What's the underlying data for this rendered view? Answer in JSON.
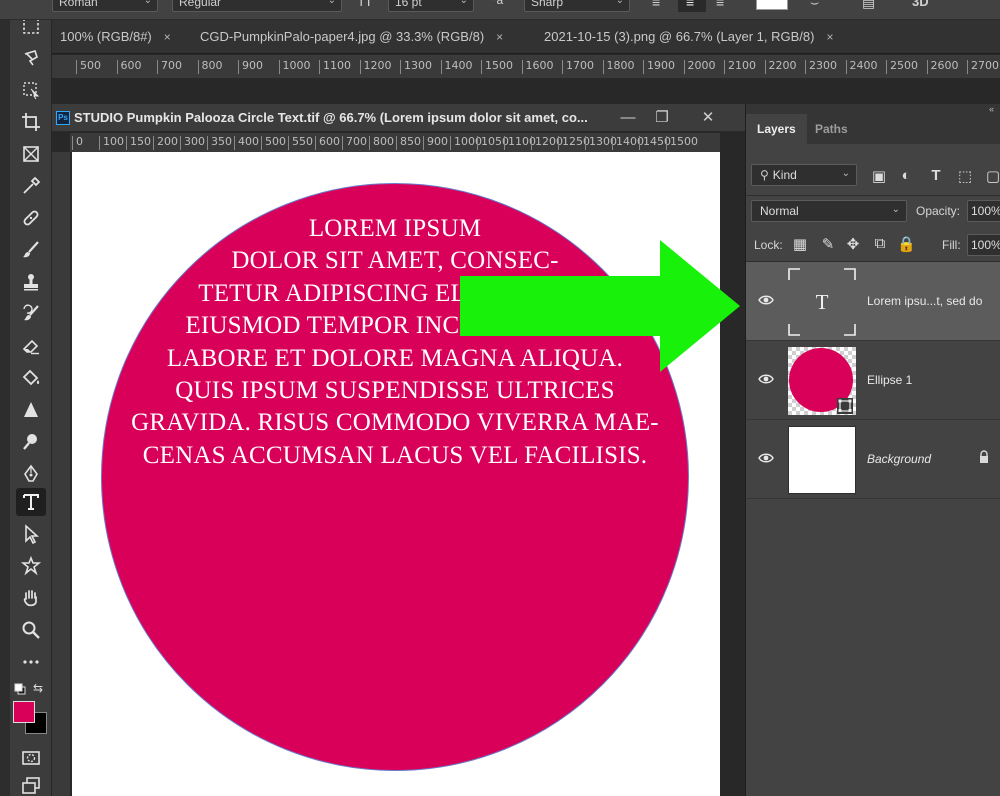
{
  "options_bar": {
    "font_family": "Roman",
    "font_style": "Regular",
    "font_size": "16 pt",
    "anti_alias": "Sharp"
  },
  "document_tabs": [
    {
      "label": "100% (RGB/8#)",
      "close": "×"
    },
    {
      "label": "CGD-PumpkinPalo-paper4.jpg @ 33.3% (RGB/8)",
      "close": "×"
    },
    {
      "label": "2021-10-15 (3).png @ 66.7% (Layer 1, RGB/8)",
      "close": "×"
    }
  ],
  "ruler_top_ticks": [
    "500",
    "600",
    "700",
    "800",
    "900",
    "1000",
    "1100",
    "1200",
    "1300",
    "1400",
    "1500",
    "1600",
    "1700",
    "1800",
    "1900",
    "2000",
    "2100",
    "2200",
    "2300",
    "2400",
    "2500",
    "2600",
    "2700"
  ],
  "doc_window": {
    "badge": "Ps",
    "title": "STUDIO Pumpkin Palooza Circle Text.tif @ 66.7% (Lorem ipsum dolor sit amet, co...",
    "minimize": "—",
    "restore": "❐",
    "close": "✕",
    "ruler_ticks": [
      "0",
      "100",
      "150",
      "200",
      "300",
      "350",
      "400",
      "500",
      "550",
      "600",
      "700",
      "800",
      "850",
      "900",
      "1000",
      "1050",
      "1100",
      "1200",
      "1250",
      "1300",
      "1400",
      "1450",
      "1500"
    ]
  },
  "canvas": {
    "circle_color": "#d9005a",
    "text_lines": [
      "LOREM IPSUM",
      "DOLOR SIT AMET, CONSEC-",
      "TETUR ADIPISCING ELIT, SED DO",
      "EIUSMOD TEMPOR INCIDIDUNT UT",
      "LABORE ET DOLORE MAGNA ALIQUA.",
      "QUIS IPSUM SUSPENDISSE ULTRICES",
      "GRAVIDA. RISUS COMMODO VIVERRA MAE-",
      "CENAS ACCUMSAN LACUS VEL FACILISIS."
    ]
  },
  "colors": {
    "foreground": "#d9005a",
    "background": "#000000",
    "arrow": "#18f20a"
  },
  "layers_panel": {
    "tabs": [
      "Layers",
      "Paths"
    ],
    "active_tab": "Layers",
    "filter_label": "Kind",
    "blend_mode": "Normal",
    "opacity_label": "Opacity:",
    "opacity_value": "100%",
    "lock_label": "Lock:",
    "fill_label": "Fill:",
    "fill_value": "100%",
    "layers": [
      {
        "name": "Lorem ipsu...t, sed do",
        "type": "text",
        "thumb_glyph": "T",
        "visible": true,
        "selected": true
      },
      {
        "name": "Ellipse 1",
        "type": "shape",
        "visible": true,
        "selected": false
      },
      {
        "name": "Background",
        "type": "background",
        "visible": true,
        "locked": true,
        "selected": false
      }
    ]
  },
  "toolbar": {
    "tools": [
      "marquee-tool",
      "lasso-tool",
      "object-select-tool",
      "crop-tool",
      "frame-tool",
      "eyedropper-tool",
      "healing-brush-tool",
      "brush-tool",
      "clone-stamp-tool",
      "history-brush-tool",
      "eraser-tool",
      "paint-bucket-tool",
      "blur-tool",
      "dodge-tool",
      "pen-tool",
      "type-tool",
      "path-select-tool",
      "custom-shape-tool",
      "hand-tool",
      "zoom-tool",
      "more-tools"
    ],
    "active_tool": "type-tool"
  }
}
